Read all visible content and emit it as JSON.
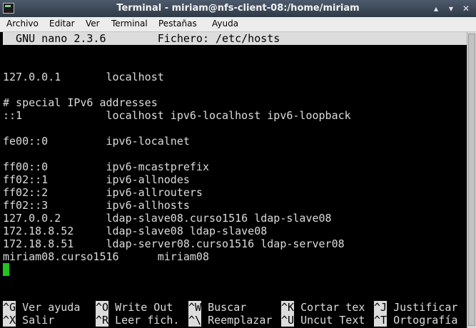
{
  "window": {
    "title": "Terminal - miriam@nfs-client-08:/home/miriam",
    "buttons": [
      "▴",
      "▾",
      "✕"
    ]
  },
  "menu": [
    "Archivo",
    "Editar",
    "Ver",
    "Terminal",
    "Pestañas",
    "Ayuda"
  ],
  "nano": {
    "header": "  GNU nano 2.3.6        Fichero: /etc/hosts",
    "lines": [
      "",
      "127.0.0.1       localhost",
      "",
      "# special IPv6 addresses",
      "::1             localhost ipv6-localhost ipv6-loopback",
      "",
      "fe00::0         ipv6-localnet",
      "",
      "ff00::0         ipv6-mcastprefix",
      "ff02::1         ipv6-allnodes",
      "ff02::2         ipv6-allrouters",
      "ff02::3         ipv6-allhosts",
      "127.0.0.2       ldap-slave08.curso1516 ldap-slave08",
      "172.18.8.52     ldap-slave08 ldap-slave08",
      "172.18.8.51     ldap-server08.curso1516 ldap-server08",
      "miriam08.curso1516      miriam08"
    ],
    "shortcuts_row1": [
      {
        "key": "^G",
        "label": " Ver ayuda"
      },
      {
        "key": "^O",
        "label": " Write Out"
      },
      {
        "key": "^W",
        "label": " Buscar"
      },
      {
        "key": "^K",
        "label": " Cortar tex"
      },
      {
        "key": "^J",
        "label": " Justificar"
      }
    ],
    "shortcuts_row2": [
      {
        "key": "^X",
        "label": " Salir"
      },
      {
        "key": "^R",
        "label": " Leer fich."
      },
      {
        "key": "^\\",
        "label": " Reemplazar"
      },
      {
        "key": "^U",
        "label": " Uncut Text"
      },
      {
        "key": "^T",
        "label": " Ortografía"
      }
    ]
  }
}
